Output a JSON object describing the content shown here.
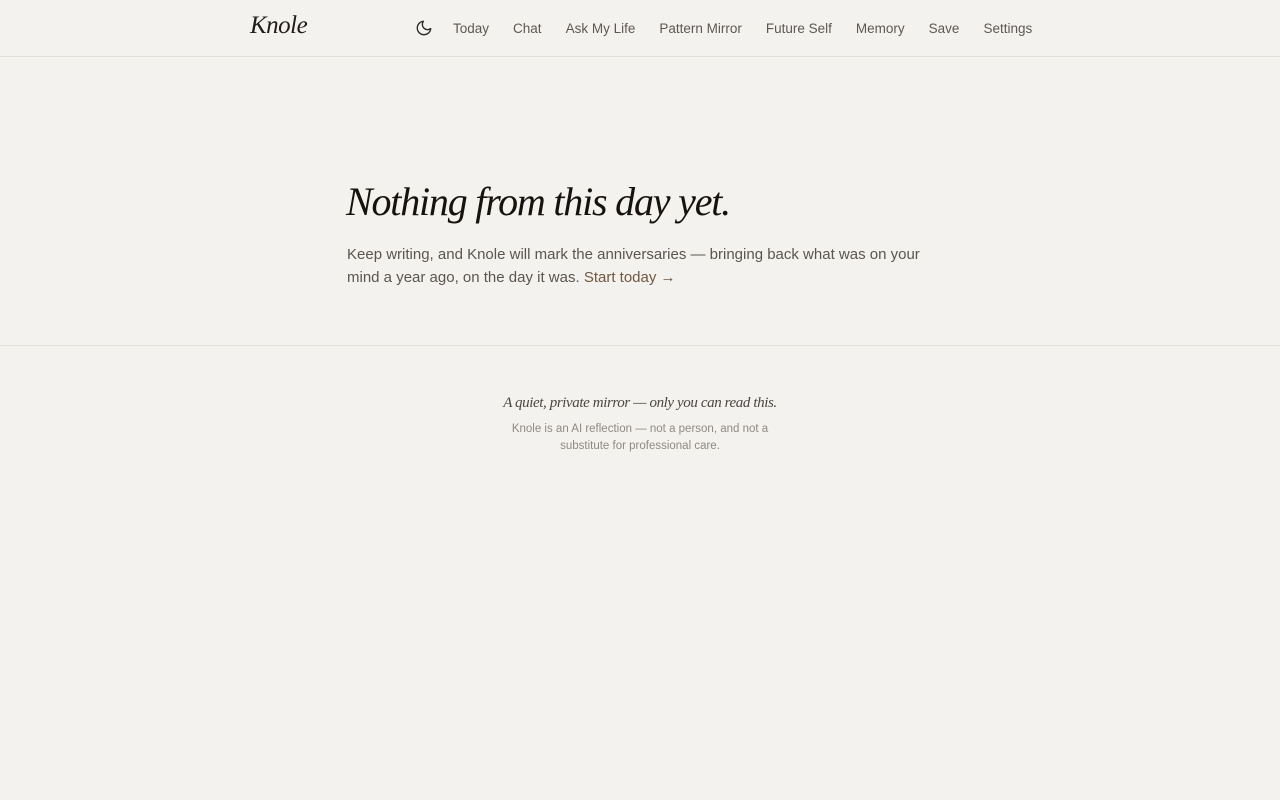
{
  "brand": "Knole",
  "nav": {
    "theme_toggle_icon": "moon-icon",
    "items": [
      "Today",
      "Chat",
      "Ask My Life",
      "Pattern Mirror",
      "Future Self",
      "Memory",
      "Save",
      "Settings"
    ]
  },
  "hero": {
    "title": "Nothing from this day yet.",
    "body": "Keep writing, and Knole will mark the anniversaries — bringing back what was on your mind a year ago, on the day it was.",
    "link": "Start today →"
  },
  "footer": {
    "tagline": "A quiet, private mirror — only you can read this.",
    "disclaimer": "Knole is an AI reflection — not a person, and not a substitute for professional care."
  },
  "colors": {
    "background": "#f4f2ee",
    "text": "#2b2825",
    "muted": "#8e8982",
    "accent_link": "#6f5a3d"
  }
}
